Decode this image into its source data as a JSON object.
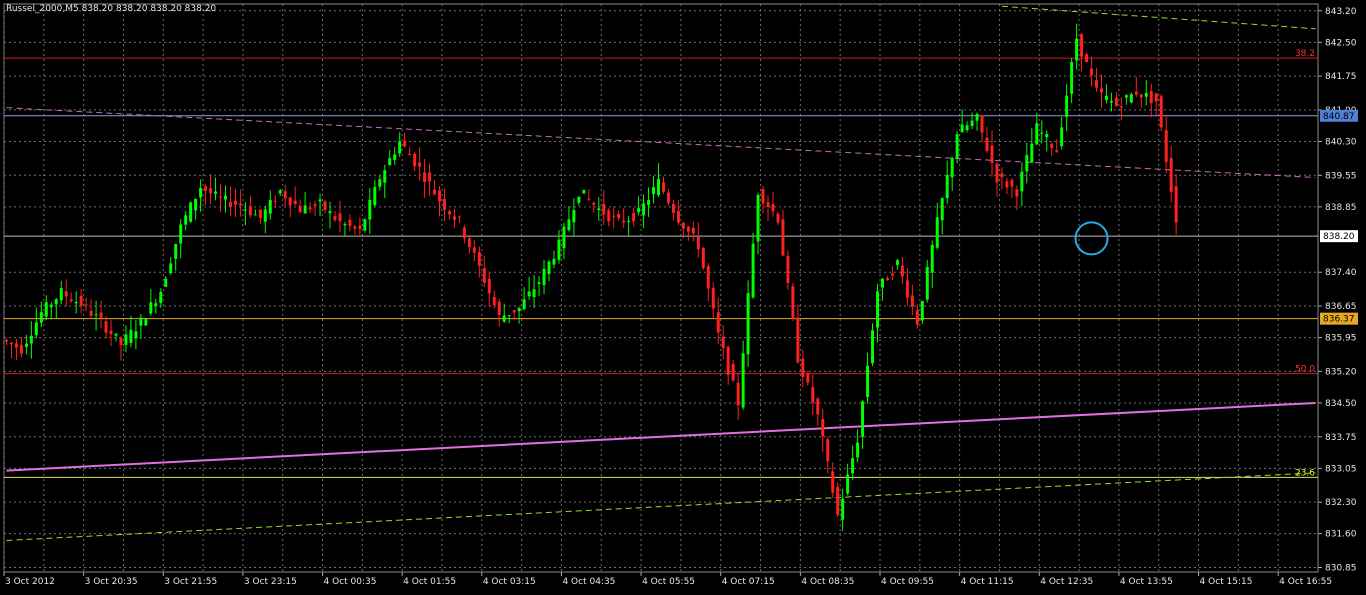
{
  "chart_data": {
    "type": "candlestick",
    "symbol": "Russel_2000,M5",
    "ohlc_readout": "838.20 838.20 838.20 838.20",
    "colors": {
      "background": "#000000",
      "grid": "#6e6e6e",
      "bull": "#00ff00",
      "bear": "#ff2020",
      "axis_text": "#e6e6e6"
    },
    "grid": true,
    "y_axis": {
      "position": "right",
      "ylim": [
        830.75,
        843.35
      ],
      "ticks": [
        "843.20",
        "842.50",
        "841.75",
        "841.00",
        "840.30",
        "839.55",
        "838.85",
        "837.40",
        "836.65",
        "835.95",
        "835.20",
        "834.50",
        "833.75",
        "833.05",
        "832.30",
        "831.60",
        "830.85"
      ],
      "tick_values": [
        843.2,
        842.5,
        841.75,
        841.0,
        840.3,
        839.55,
        838.85,
        837.4,
        836.65,
        835.95,
        835.2,
        834.5,
        833.75,
        833.05,
        832.3,
        831.6,
        830.85
      ]
    },
    "x_axis": {
      "ticks": [
        "3 Oct 2012",
        "3 Oct 20:35",
        "3 Oct 21:55",
        "3 Oct 23:15",
        "4 Oct 00:35",
        "4 Oct 01:55",
        "4 Oct 03:15",
        "4 Oct 04:35",
        "4 Oct 05:55",
        "4 Oct 07:15",
        "4 Oct 08:35",
        "4 Oct 09:55",
        "4 Oct 11:15",
        "4 Oct 12:35",
        "4 Oct 13:55",
        "4 Oct 15:15",
        "4 Oct 16:55"
      ],
      "bar_count": 264
    },
    "price_labels": [
      {
        "value": 840.87,
        "text": "840.87",
        "color": "#4f7fd9"
      },
      {
        "value": 838.2,
        "text": "838.20",
        "color": "#ffffff"
      },
      {
        "value": 836.37,
        "text": "836.37",
        "color": "#e6a820"
      }
    ],
    "levels": [
      {
        "name": "38.2",
        "value": 842.15,
        "color": "#cc2020",
        "label_color": "#ff3030"
      },
      {
        "name": "50.0",
        "value": 835.15,
        "color": "#cc2020",
        "label_color": "#ff3030"
      },
      {
        "name": "23.6",
        "value": 832.85,
        "color": "#e0e060",
        "label_color": "#ffff40"
      },
      {
        "name": "",
        "value": 836.37,
        "color": "#e6a820",
        "label_color": ""
      },
      {
        "name": "",
        "value": 840.87,
        "color": "#8aa0e0",
        "label_color": ""
      },
      {
        "name": "",
        "value": 838.2,
        "color": "#bbbbbb",
        "label_color": ""
      }
    ],
    "trendlines": [
      {
        "from": [
          0,
          841.05
        ],
        "to": [
          263,
          839.5
        ],
        "color": "#c070c0",
        "style": "dashed",
        "width": 1
      },
      {
        "from": [
          0,
          833.0
        ],
        "to": [
          263,
          834.5
        ],
        "color": "#e070e0",
        "style": "solid",
        "width": 2
      },
      {
        "from": [
          0,
          831.45
        ],
        "to": [
          263,
          832.95
        ],
        "color": "#90e030",
        "style": "dashed",
        "width": 1
      },
      {
        "from": [
          200,
          843.3
        ],
        "to": [
          263,
          842.8
        ],
        "color": "#90e030",
        "style": "dashed",
        "width": 1
      }
    ],
    "marker": {
      "type": "circle",
      "bar": 218,
      "value": 838.15,
      "color": "#2aa8e0"
    },
    "anchors": [
      [
        0,
        835.9
      ],
      [
        4,
        835.7
      ],
      [
        8,
        836.5
      ],
      [
        12,
        836.95
      ],
      [
        16,
        836.7
      ],
      [
        20,
        836.3
      ],
      [
        24,
        835.8
      ],
      [
        28,
        836.3
      ],
      [
        32,
        837.0
      ],
      [
        36,
        838.4
      ],
      [
        40,
        839.3
      ],
      [
        44,
        839.0
      ],
      [
        48,
        838.9
      ],
      [
        52,
        838.6
      ],
      [
        56,
        839.2
      ],
      [
        60,
        838.8
      ],
      [
        64,
        838.9
      ],
      [
        68,
        838.5
      ],
      [
        72,
        838.3
      ],
      [
        76,
        839.5
      ],
      [
        80,
        840.3
      ],
      [
        84,
        839.7
      ],
      [
        88,
        839.0
      ],
      [
        92,
        838.5
      ],
      [
        96,
        837.5
      ],
      [
        100,
        836.4
      ],
      [
        104,
        836.6
      ],
      [
        108,
        837.2
      ],
      [
        112,
        838.0
      ],
      [
        116,
        839.2
      ],
      [
        120,
        838.8
      ],
      [
        124,
        838.5
      ],
      [
        128,
        838.7
      ],
      [
        132,
        839.4
      ],
      [
        136,
        838.6
      ],
      [
        140,
        838.0
      ],
      [
        144,
        836.0
      ],
      [
        148,
        834.5
      ],
      [
        152,
        839.2
      ],
      [
        156,
        838.6
      ],
      [
        160,
        835.5
      ],
      [
        164,
        834.2
      ],
      [
        168,
        832.0
      ],
      [
        172,
        833.7
      ],
      [
        176,
        837.0
      ],
      [
        180,
        837.6
      ],
      [
        184,
        836.3
      ],
      [
        188,
        838.5
      ],
      [
        192,
        840.5
      ],
      [
        196,
        840.8
      ],
      [
        200,
        839.5
      ],
      [
        204,
        839.2
      ],
      [
        208,
        840.6
      ],
      [
        212,
        840.1
      ],
      [
        216,
        842.6
      ],
      [
        220,
        841.4
      ],
      [
        224,
        841.1
      ],
      [
        228,
        841.4
      ],
      [
        232,
        841.2
      ],
      [
        236,
        838.6
      ]
    ]
  }
}
